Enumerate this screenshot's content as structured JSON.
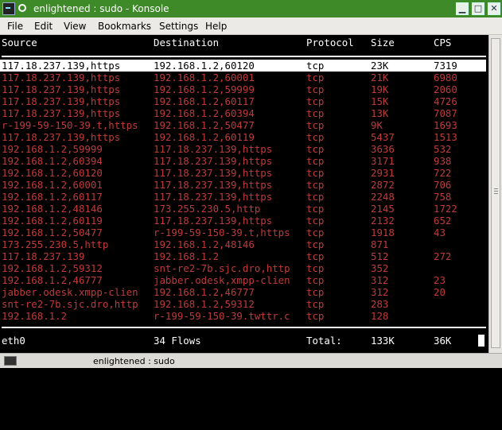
{
  "window": {
    "title": "enlightened : sudo - Konsole"
  },
  "menu": [
    "File",
    "Edit",
    "View",
    "Bookmarks",
    "Settings",
    "Help"
  ],
  "table": {
    "headers": [
      "Source",
      "Destination",
      "Protocol",
      "Size",
      "CPS"
    ],
    "rows": [
      [
        "117.18.237.139,https",
        "192.168.1.2,60120",
        "tcp",
        "23K",
        "7319"
      ],
      [
        "117.18.237.139,https",
        "192.168.1.2,60001",
        "tcp",
        "21K",
        "6980"
      ],
      [
        "117.18.237.139,https",
        "192.168.1.2,59999",
        "tcp",
        "19K",
        "2060"
      ],
      [
        "117.18.237.139,https",
        "192.168.1.2,60117",
        "tcp",
        "15K",
        "4726"
      ],
      [
        "117.18.237.139,https",
        "192.168.1.2,60394",
        "tcp",
        "13K",
        "7087"
      ],
      [
        "r-199-59-150-39.t,https",
        "192.168.1.2,50477",
        "tcp",
        "9K",
        "1693"
      ],
      [
        "117.18.237.139,https",
        "192.168.1.2,60119",
        "tcp",
        "5437",
        "1513"
      ],
      [
        "192.168.1.2,59999",
        "117.18.237.139,https",
        "tcp",
        "3636",
        "532"
      ],
      [
        "192.168.1.2,60394",
        "117.18.237.139,https",
        "tcp",
        "3171",
        "938"
      ],
      [
        "192.168.1.2,60120",
        "117.18.237.139,https",
        "tcp",
        "2931",
        "722"
      ],
      [
        "192.168.1.2,60001",
        "117.18.237.139,https",
        "tcp",
        "2872",
        "706"
      ],
      [
        "192.168.1.2,60117",
        "117.18.237.139,https",
        "tcp",
        "2248",
        "758"
      ],
      [
        "192.168.1.2,48146",
        "173.255.230.5,http",
        "tcp",
        "2145",
        "1722"
      ],
      [
        "192.168.1.2,60119",
        "117.18.237.139,https",
        "tcp",
        "2132",
        "652"
      ],
      [
        "192.168.1.2,50477",
        "r-199-59-150-39.t,https",
        "tcp",
        "1918",
        "43"
      ],
      [
        "173.255.230.5,http",
        "192.168.1.2,48146",
        "tcp",
        "871",
        ""
      ],
      [
        "117.18.237.139",
        "192.168.1.2",
        "tcp",
        "512",
        "272"
      ],
      [
        "192.168.1.2,59312",
        "snt-re2-7b.sjc.dro,http",
        "tcp",
        "352",
        ""
      ],
      [
        "192.168.1.2,46777",
        "jabber.odesk,xmpp-clien",
        "tcp",
        "312",
        "23"
      ],
      [
        "jabber.odesk.xmpp-clien",
        "192.168.1.2,46777",
        "tcp",
        "312",
        "20"
      ],
      [
        "snt-re2-7b.sjc.dro,http",
        "192.168.1.2,59312",
        "tcp",
        "283",
        ""
      ],
      [
        "192.168.1.2",
        "r-199-59-150-39.twttr.c",
        "tcp",
        "128",
        ""
      ]
    ]
  },
  "footer": {
    "interface": "eth0",
    "flows": "34 Flows",
    "total_label": "Total:",
    "total_size": "133K",
    "total_cps": "36K"
  },
  "taskbar": {
    "label": "enlightened : sudo"
  }
}
